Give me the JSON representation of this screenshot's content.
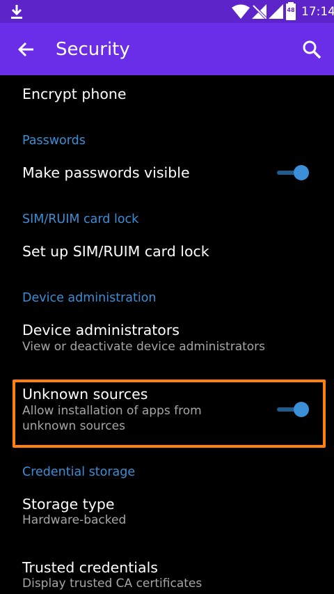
{
  "status_bar": {
    "time": "17:14",
    "battery_level": "48",
    "icons": [
      "download-icon",
      "wifi-icon",
      "no-sim-signal-icon",
      "signal-icon",
      "battery-icon"
    ]
  },
  "app_bar": {
    "title": "Security",
    "back_icon": "arrow-back-icon",
    "search_icon": "search-icon"
  },
  "colors": {
    "status_bar": "#5d25c9",
    "app_bar": "#6a2ee8",
    "background": "#000000",
    "header_text": "#3a8fd6",
    "toggle_on": "#3a8fd6",
    "highlight": "#ff7f0f"
  },
  "items": {
    "encrypt_phone": {
      "title": "Encrypt phone"
    },
    "passwords_header": "Passwords",
    "make_passwords_visible": {
      "title": "Make passwords visible",
      "toggle": true
    },
    "sim_header": "SIM/RUIM card lock",
    "sim_lock": {
      "title": "Set up SIM/RUIM card lock"
    },
    "device_admin_header": "Device administration",
    "device_administrators": {
      "title": "Device administrators",
      "subtitle": "View or deactivate device administrators"
    },
    "unknown_sources": {
      "title": "Unknown sources",
      "subtitle_line1": "Allow installation of apps from",
      "subtitle_line2": "unknown sources",
      "toggle": true
    },
    "credential_header": "Credential storage",
    "storage_type": {
      "title": "Storage type",
      "subtitle": "Hardware-backed"
    },
    "trusted_credentials": {
      "title": "Trusted credentials",
      "subtitle": "Display trusted CA certificates"
    }
  }
}
